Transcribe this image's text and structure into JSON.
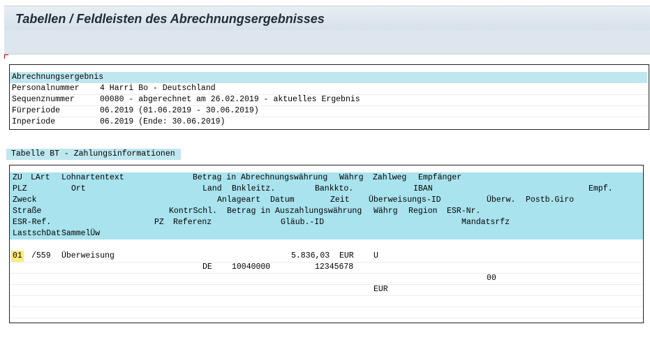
{
  "page_title": "Tabellen / Feldleisten des Abrechnungsergebnisses",
  "result_box": {
    "header": "Abrechnungsergebnis",
    "rows": [
      {
        "label": "Personalnummer",
        "value": "4 Harri Bo - Deutschland"
      },
      {
        "label": "Sequenznummer",
        "value": "00080 - abgerechnet am 26.02.2019 - aktuelles Ergebnis"
      },
      {
        "label": "Fürperiode",
        "value": "06.2019 (01.06.2019 - 30.06.2019)"
      },
      {
        "label": "Inperiode",
        "value": "06.2019 (Ende: 30.06.2019)"
      }
    ]
  },
  "table_title": "Tabelle BT - Zahlungsinformationen",
  "headers": {
    "r1": {
      "zu": "ZU",
      "lart": "LArt",
      "lohnartentext": "Lohnartentext",
      "betrag": "Betrag in Abrechnungswährung",
      "waehrg": "Währg",
      "zahlweg": "Zahlweg",
      "empfaenger": "Empfänger"
    },
    "r2": {
      "plz": "PLZ",
      "ort": "Ort",
      "land": "Land",
      "bnkleitz": "Bnkleitz.",
      "bankkto": "Bankkto.",
      "iban": "IBAN",
      "empf": "Empf."
    },
    "r3": {
      "zweck": "Zweck",
      "anlageart": "Anlageart",
      "datum": "Datum",
      "zeit": "Zeit",
      "ueberweisungsid": "Überweisungs-ID",
      "ueberw": "Überw.",
      "postbgiro": "Postb.Giro"
    },
    "r4": {
      "strasse": "Straße",
      "kontrschl": "KontrSchl.",
      "betrag_ausz": "Betrag in Auszahlungswährung",
      "waehrg": "Währg",
      "region": "Region",
      "esrnr": "ESR-Nr."
    },
    "r5": {
      "esrref": "ESR-Ref.",
      "pz": "PZ",
      "referenz": "Referenz",
      "glaeubid": "Gläub.-ID",
      "mandatsrfz": "Mandatsrfz"
    },
    "r6": {
      "lastschdat": "LastschDat",
      "sammelueb": "SammelÜw"
    }
  },
  "record": {
    "zu": "01",
    "lart": "/559",
    "lohnartentext": "Überweisung",
    "betrag": "5.836,03",
    "waehrg": "EUR",
    "zahlweg": "U",
    "land": "DE",
    "bnkleitz": "10040000",
    "bankkto": "12345678",
    "ueberw": "00",
    "waehrg_ausz": "EUR"
  }
}
